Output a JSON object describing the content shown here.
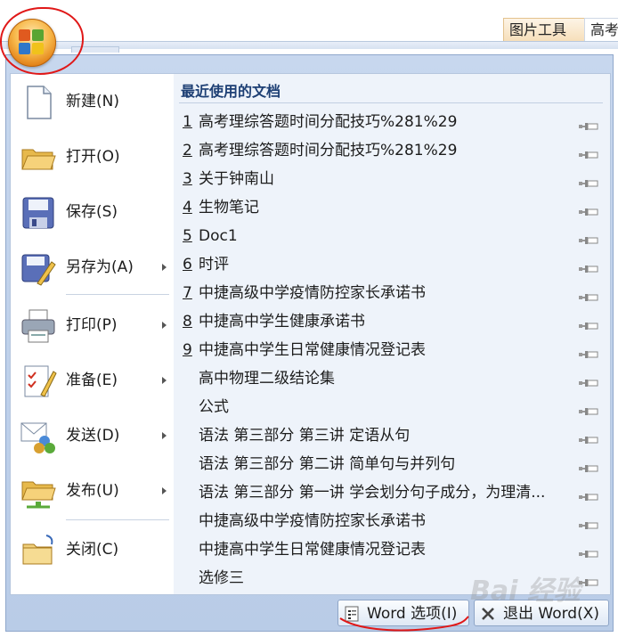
{
  "ribbon": {
    "tabs": [
      "图片工具",
      "高考"
    ]
  },
  "office_button": {
    "icon": "office-orb-icon"
  },
  "left_commands": [
    {
      "label": "新建(N)",
      "icon": "new-document-icon",
      "submenu": false
    },
    {
      "label": "打开(O)",
      "icon": "open-folder-icon",
      "submenu": false
    },
    {
      "label": "保存(S)",
      "icon": "save-disk-icon",
      "submenu": false
    },
    {
      "label": "另存为(A)",
      "icon": "save-as-icon",
      "submenu": true
    },
    {
      "label": "打印(P)",
      "icon": "printer-icon",
      "submenu": true
    },
    {
      "label": "准备(E)",
      "icon": "prepare-check-icon",
      "submenu": true
    },
    {
      "label": "发送(D)",
      "icon": "send-icon",
      "submenu": true
    },
    {
      "label": "发布(U)",
      "icon": "publish-icon",
      "submenu": true
    },
    {
      "label": "关闭(C)",
      "icon": "close-folder-icon",
      "submenu": false
    }
  ],
  "recent": {
    "title": "最近使用的文档",
    "documents": [
      {
        "num": "1",
        "name": "高考理综答题时间分配技巧%281%29"
      },
      {
        "num": "2",
        "name": "高考理综答题时间分配技巧%281%29"
      },
      {
        "num": "3",
        "name": "关于钟南山"
      },
      {
        "num": "4",
        "name": "生物笔记"
      },
      {
        "num": "5",
        "name": "Doc1"
      },
      {
        "num": "6",
        "name": "时评"
      },
      {
        "num": "7",
        "name": "中捷高级中学疫情防控家长承诺书"
      },
      {
        "num": "8",
        "name": "中捷高中学生健康承诺书"
      },
      {
        "num": "9",
        "name": "中捷高中学生日常健康情况登记表"
      },
      {
        "num": "",
        "name": "高中物理二级结论集"
      },
      {
        "num": "",
        "name": "公式"
      },
      {
        "num": "",
        "name": "语法  第三部分  第三讲 定语从句"
      },
      {
        "num": "",
        "name": "语法  第三部分  第二讲 简单句与并列句"
      },
      {
        "num": "",
        "name": "语法  第三部分  第一讲 学会划分句子成分，为理清..."
      },
      {
        "num": "",
        "name": "中捷高级中学疫情防控家长承诺书"
      },
      {
        "num": "",
        "name": "中捷高中学生日常健康情况登记表"
      },
      {
        "num": "",
        "name": "选修三"
      }
    ]
  },
  "buttons": {
    "options": "Word 选项(I)",
    "exit": "退出 Word(X)"
  },
  "watermark": "Bai 经验",
  "colors": {
    "accent": "#1d3f74",
    "annotation": "#e01818"
  }
}
